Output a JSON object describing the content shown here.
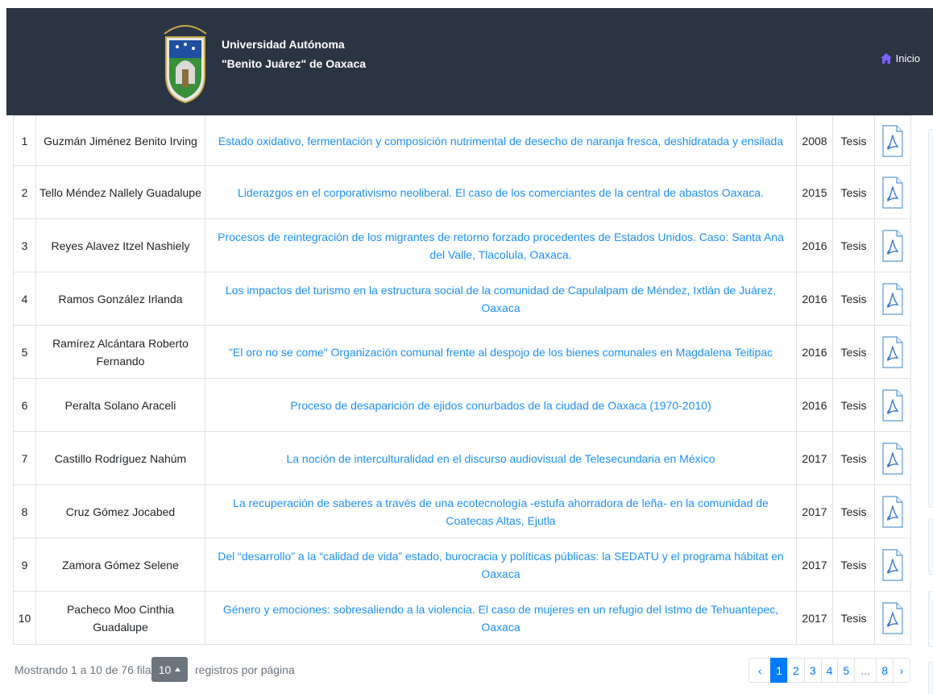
{
  "header": {
    "brand_line1": "Universidad Autónoma",
    "brand_line2": "\"Benito Juárez\" de Oaxaca",
    "nav_inicio": "Inicio",
    "icon": "home-icon",
    "home_icon_color": "#7b61ff",
    "background": "#2b3442"
  },
  "table": {
    "rows": [
      {
        "n": "1",
        "author": "Guzmán Jiménez Benito Irving",
        "title": "Estado oxidativo, fermentación y composición nutrimental de desecho de naranja fresca, deshidratada y ensilada",
        "year": "2008",
        "type": "Tesis",
        "icon": "pdf-icon"
      },
      {
        "n": "2",
        "author": "Tello Méndez Nallely Guadalupe",
        "title": "Liderazgos en el corporativismo neoliberal. El caso de los comerciantes de la central de abastos Oaxaca.",
        "year": "2015",
        "type": "Tesis",
        "icon": "pdf-icon"
      },
      {
        "n": "3",
        "author": "Reyes Alavez Itzel Nashiely",
        "title": "Procesos de reintegración de los migrantes de retorno forzado procedentes de Estados Unidos. Caso: Santa Ana del Valle, Tlacolula, Oaxaca.",
        "year": "2016",
        "type": "Tesis",
        "icon": "pdf-icon"
      },
      {
        "n": "4",
        "author": "Ramos González Irlanda",
        "title": "Los impactos del turismo en la estructura social de la comunidad de Capulalpam de Méndez, Ixtlán de Juárez, Oaxaca",
        "year": "2016",
        "type": "Tesis",
        "icon": "pdf-icon"
      },
      {
        "n": "5",
        "author": "Ramírez Alcántara Roberto Fernando",
        "title": "\"El oro no se come\" Organización comunal frente al despojo de los bienes comunales en Magdalena Teitipac",
        "year": "2016",
        "type": "Tesis",
        "icon": "pdf-icon"
      },
      {
        "n": "6",
        "author": "Peralta Solano Araceli",
        "title": "Proceso de desaparición de ejidos conurbados de la ciudad de Oaxaca (1970-2010)",
        "year": "2016",
        "type": "Tesis",
        "icon": "pdf-icon"
      },
      {
        "n": "7",
        "author": "Castillo Rodríguez Nahúm",
        "title": "La noción de interculturalidad en el discurso audiovisual de Telesecundaria en México",
        "year": "2017",
        "type": "Tesis",
        "icon": "pdf-icon"
      },
      {
        "n": "8",
        "author": "Cruz Gómez Jocabed",
        "title": "La recuperación de saberes a través de una ecotecnología -estufa ahorradora de leña- en la comunidad de Coatecas Altas, Ejutla",
        "year": "2017",
        "type": "Tesis",
        "icon": "pdf-icon"
      },
      {
        "n": "9",
        "author": "Zamora Gómez Selene",
        "title": "Del “desarrollo” a la “calidad de vida” estado, burocracia y políticas públicas: la SEDATU y el programa hábitat en Oaxaca",
        "year": "2017",
        "type": "Tesis",
        "icon": "pdf-icon"
      },
      {
        "n": "10",
        "author": "Pacheco Moo Cinthia Guadalupe",
        "title": "Género y emociones: sobresaliendo a la violencia. El caso de mujeres en un refugio del Istmo de Tehuantepec, Oaxaca",
        "year": "2017",
        "type": "Tesis",
        "icon": "pdf-icon"
      }
    ]
  },
  "footer": {
    "showing": "Mostrando 1 a 10 de 76 filas",
    "page_size": "10",
    "per_page_label": "registros por página",
    "caret_icon": "caret-up-icon",
    "pages": [
      {
        "label": "‹",
        "kind": "prev"
      },
      {
        "label": "1",
        "kind": "active"
      },
      {
        "label": "2",
        "kind": "page"
      },
      {
        "label": "3",
        "kind": "page"
      },
      {
        "label": "4",
        "kind": "page"
      },
      {
        "label": "5",
        "kind": "page"
      },
      {
        "label": "...",
        "kind": "ellipsis"
      },
      {
        "label": "8",
        "kind": "page"
      },
      {
        "label": "›",
        "kind": "next"
      }
    ]
  },
  "colors": {
    "link": "#1e90ff",
    "accent": "#007bff",
    "navbar": "#2b3442"
  }
}
